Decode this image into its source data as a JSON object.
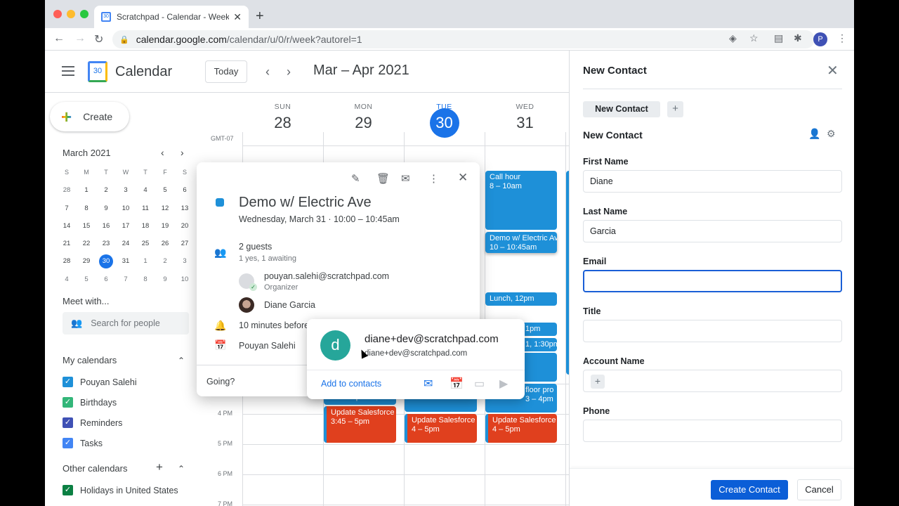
{
  "browser": {
    "tab_title": "Scratchpad - Calendar - Week",
    "url_host": "calendar.google.com",
    "url_path": "/calendar/u/0/r/week?autorel=1",
    "profile_initial": "P",
    "traffic_colors": [
      "#ff5f57",
      "#febc2e",
      "#28c840"
    ]
  },
  "header": {
    "app_name": "Calendar",
    "logo_day": "30",
    "today_label": "Today",
    "range_title": "Mar – Apr 2021"
  },
  "sidebar": {
    "create_label": "Create",
    "mini_cal": {
      "title": "March 2021",
      "dow": [
        "S",
        "M",
        "T",
        "W",
        "T",
        "F",
        "S"
      ],
      "weeks": [
        [
          "28",
          "1",
          "2",
          "3",
          "4",
          "5",
          "6"
        ],
        [
          "7",
          "8",
          "9",
          "10",
          "11",
          "12",
          "13"
        ],
        [
          "14",
          "15",
          "16",
          "17",
          "18",
          "19",
          "20"
        ],
        [
          "21",
          "22",
          "23",
          "24",
          "25",
          "26",
          "27"
        ],
        [
          "28",
          "29",
          "30",
          "31",
          "1",
          "2",
          "3"
        ],
        [
          "4",
          "5",
          "6",
          "7",
          "8",
          "9",
          "10"
        ]
      ],
      "selected": "30"
    },
    "meet_with": "Meet with...",
    "search_people_placeholder": "Search for people",
    "my_calendars_title": "My calendars",
    "my_calendars": [
      {
        "label": "Pouyan Salehi",
        "color": "#1e90d8"
      },
      {
        "label": "Birthdays",
        "color": "#33b679"
      },
      {
        "label": "Reminders",
        "color": "#3f51b5"
      },
      {
        "label": "Tasks",
        "color": "#4285f4"
      }
    ],
    "other_calendars_title": "Other calendars",
    "other_calendars": [
      {
        "label": "Holidays in United States",
        "color": "#0b8043"
      }
    ]
  },
  "week": {
    "timezone": "GMT-07",
    "days": [
      {
        "name": "SUN",
        "num": "28"
      },
      {
        "name": "MON",
        "num": "29"
      },
      {
        "name": "TUE",
        "num": "30",
        "today": true
      },
      {
        "name": "WED",
        "num": "31"
      }
    ],
    "hour_labels": [
      "4 PM",
      "5 PM",
      "6 PM",
      "7 PM"
    ],
    "events": [
      {
        "title": "Call hour",
        "time": "8 – 10am",
        "color": "blue"
      },
      {
        "title": "Demo w/ Electric Ave",
        "time": "10 – 10:45am",
        "color": "blue"
      },
      {
        "title": "Lunch, 12pm",
        "time": "",
        "color": "blue"
      },
      {
        "title": "1pm",
        "time": "",
        "color": "blue"
      },
      {
        "title": "1, 1:30pm",
        "time": "",
        "color": "blue"
      },
      {
        "title": "floor pro",
        "time": "3 – 4pm",
        "color": "blue"
      },
      {
        "title": "Update Salesforce",
        "time": "3:45 – 5pm",
        "color": "red"
      },
      {
        "title": "Update Salesforce",
        "time": "4 – 5pm",
        "color": "red"
      },
      {
        "title": "Update Salesforce",
        "time": "4 – 5pm",
        "color": "red"
      },
      {
        "title": "3 – 3:45pm",
        "time": "",
        "color": "blue"
      }
    ]
  },
  "event_popover": {
    "title": "Demo w/ Electric Ave",
    "when": "Wednesday, March 31  ·  10:00 – 10:45am",
    "guests_count": "2 guests",
    "guests_status": "1 yes, 1 awaiting",
    "guests": [
      {
        "name": "pouyan.salehi@scratchpad.com",
        "role": "Organizer"
      },
      {
        "name": "Diane Garcia",
        "role": ""
      }
    ],
    "reminder": "10 minutes before",
    "calendar_owner": "Pouyan Salehi",
    "going_label": "Going?"
  },
  "hover_card": {
    "avatar_initial": "d",
    "name": "diane+dev@scratchpad.com",
    "email": "diane+dev@scratchpad.com",
    "add_label": "Add to contacts"
  },
  "panel": {
    "title": "New Contact",
    "tab_label": "New Contact",
    "form_title": "New Contact",
    "fields": [
      {
        "label": "First Name",
        "value": "Diane"
      },
      {
        "label": "Last Name",
        "value": "Garcia"
      },
      {
        "label": "Email",
        "value": ""
      },
      {
        "label": "Title",
        "value": ""
      },
      {
        "label": "Account Name",
        "value": ""
      },
      {
        "label": "Phone",
        "value": ""
      }
    ],
    "create_label": "Create Contact",
    "cancel_label": "Cancel"
  }
}
